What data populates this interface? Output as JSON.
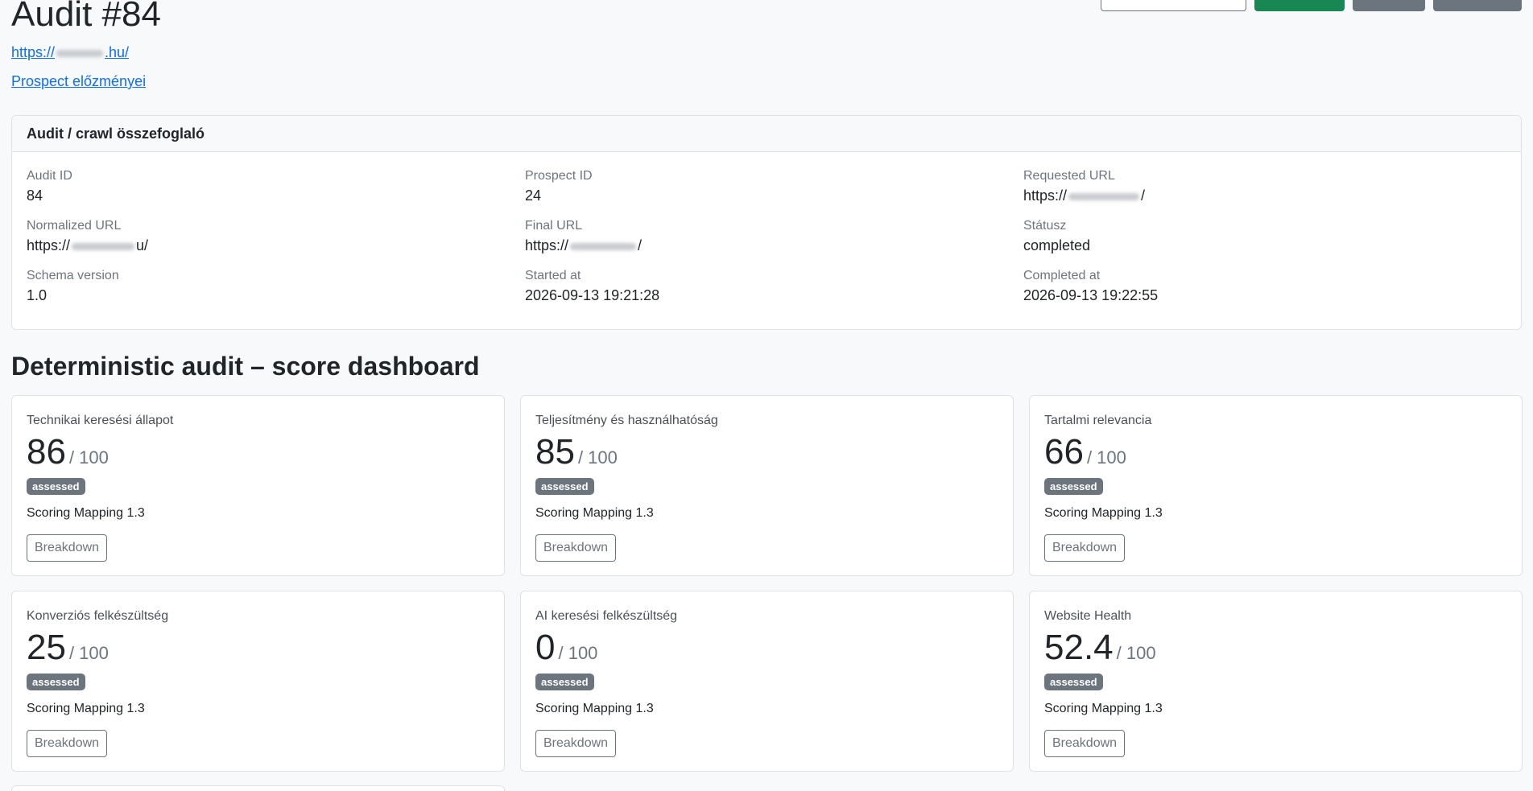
{
  "page": {
    "title": "Audit #84",
    "site_url_prefix": "https://",
    "site_url_suffix": ".hu/",
    "prospect_link": "Prospect előzményei"
  },
  "summary": {
    "header": "Audit / crawl összefoglaló",
    "fields": [
      {
        "label": "Audit ID",
        "value": "84"
      },
      {
        "label": "Prospect ID",
        "value": "24"
      },
      {
        "label": "Requested URL",
        "value_prefix": "https://",
        "value_suffix": "/"
      },
      {
        "label": "Normalized URL",
        "value_prefix": "https://",
        "value_suffix": "u/"
      },
      {
        "label": "Final URL",
        "value_prefix": "https://",
        "value_suffix": "/"
      },
      {
        "label": "Státusz",
        "value": "completed"
      },
      {
        "label": "Schema version",
        "value": "1.0"
      },
      {
        "label": "Started at",
        "value": "2026-09-13 19:21:28"
      },
      {
        "label": "Completed at",
        "value": "2026-09-13 19:22:55"
      }
    ]
  },
  "dashboard": {
    "title": "Deterministic audit – score dashboard",
    "max_label": "/ 100",
    "badge": "assessed",
    "mapping": "Scoring Mapping 1.3",
    "button": "Breakdown",
    "cards": [
      {
        "label": "Technikai keresési állapot",
        "score": "86"
      },
      {
        "label": "Teljesítmény és használhatóság",
        "score": "85"
      },
      {
        "label": "Tartalmi relevancia",
        "score": "66"
      },
      {
        "label": "Konverziós felkészültség",
        "score": "25"
      },
      {
        "label": "AI keresési felkészültség",
        "score": "0"
      },
      {
        "label": "Website Health",
        "score": "52.4"
      }
    ]
  },
  "colors": {
    "link": "#0d6efd",
    "success": "#198754",
    "secondary": "#6c757d",
    "background": "#f8f9fa"
  }
}
